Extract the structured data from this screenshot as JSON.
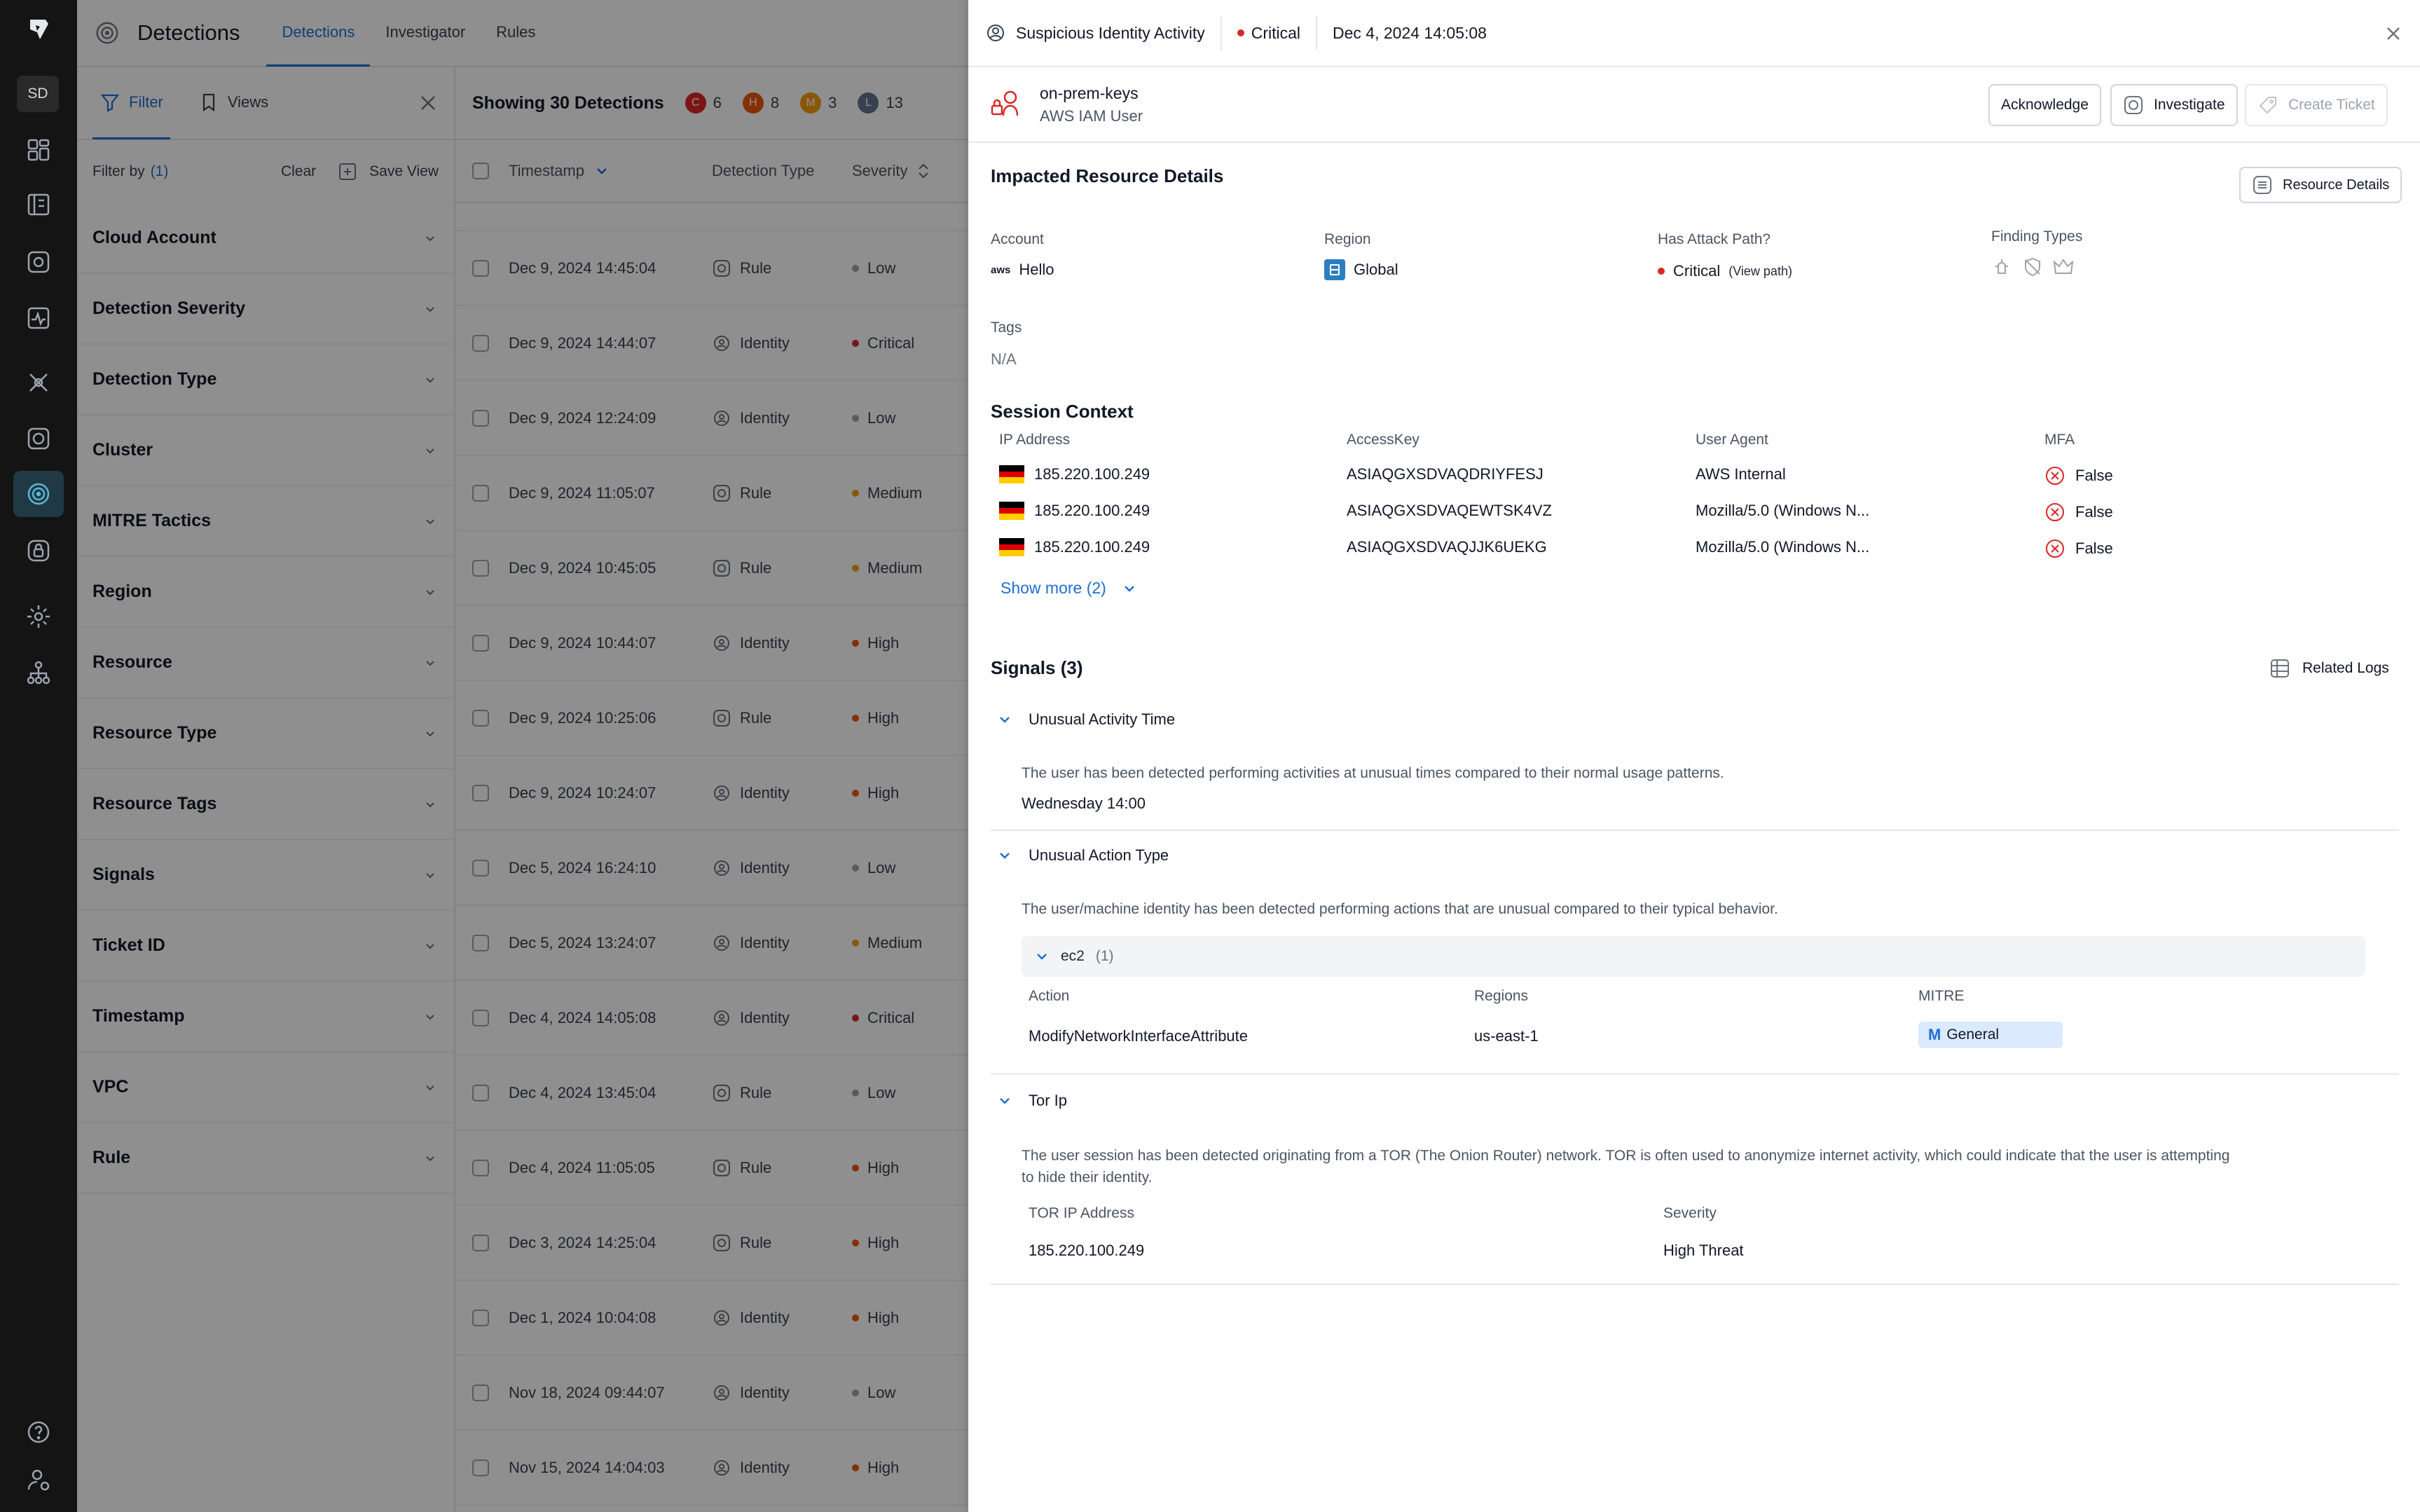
{
  "rail": {
    "workspace": "SD",
    "icons": [
      "dashboard-icon",
      "inventory-icon",
      "explorer-icon",
      "posture-icon",
      "activity-icon",
      "vulnerability-icon",
      "compliance-icon",
      "detections-icon",
      "identity-icon",
      "settings-icon",
      "org-icon"
    ],
    "bottom": [
      "help-icon",
      "user-settings-icon"
    ]
  },
  "app": {
    "title": "Detections",
    "tabs": [
      "Detections",
      "Investigator",
      "Rules"
    ]
  },
  "filter_panel": {
    "tabs": [
      "Filter",
      "Views"
    ],
    "filter_by": "Filter by",
    "filter_count": "(1)",
    "clear": "Clear",
    "save_view": "Save View",
    "groups": [
      "Cloud Account",
      "Detection Severity",
      "Detection Type",
      "Cluster",
      "MITRE Tactics",
      "Region",
      "Resource",
      "Resource Type",
      "Resource Tags",
      "Signals",
      "Ticket ID",
      "Timestamp",
      "VPC",
      "Rule"
    ]
  },
  "detections_table": {
    "showing": "Showing 30 Detections",
    "severity_counts": [
      {
        "letter": "C",
        "count": "6",
        "color": "#dc2626"
      },
      {
        "letter": "H",
        "count": "8",
        "color": "#ea580c"
      },
      {
        "letter": "M",
        "count": "3",
        "color": "#f59e0b"
      },
      {
        "letter": "L",
        "count": "13",
        "color": "#64748b"
      }
    ],
    "columns": [
      "Timestamp",
      "Detection Type",
      "Severity"
    ],
    "rows": [
      {
        "ts": "Dec 9, 2024 14:45:04",
        "type": "Rule",
        "sev": "Low"
      },
      {
        "ts": "Dec 9, 2024 14:44:07",
        "type": "Identity",
        "sev": "Critical"
      },
      {
        "ts": "Dec 9, 2024 12:24:09",
        "type": "Identity",
        "sev": "Low"
      },
      {
        "ts": "Dec 9, 2024 11:05:07",
        "type": "Rule",
        "sev": "Medium"
      },
      {
        "ts": "Dec 9, 2024 10:45:05",
        "type": "Rule",
        "sev": "Medium"
      },
      {
        "ts": "Dec 9, 2024 10:44:07",
        "type": "Identity",
        "sev": "High"
      },
      {
        "ts": "Dec 9, 2024 10:25:06",
        "type": "Rule",
        "sev": "High"
      },
      {
        "ts": "Dec 9, 2024 10:24:07",
        "type": "Identity",
        "sev": "High"
      },
      {
        "ts": "Dec 5, 2024 16:24:10",
        "type": "Identity",
        "sev": "Low"
      },
      {
        "ts": "Dec 5, 2024 13:24:07",
        "type": "Identity",
        "sev": "Medium"
      },
      {
        "ts": "Dec 4, 2024 14:05:08",
        "type": "Identity",
        "sev": "Critical"
      },
      {
        "ts": "Dec 4, 2024 13:45:04",
        "type": "Rule",
        "sev": "Low"
      },
      {
        "ts": "Dec 4, 2024 11:05:05",
        "type": "Rule",
        "sev": "High"
      },
      {
        "ts": "Dec 3, 2024 14:25:04",
        "type": "Rule",
        "sev": "High"
      },
      {
        "ts": "Dec 1, 2024 10:04:08",
        "type": "Identity",
        "sev": "High"
      },
      {
        "ts": "Nov 18, 2024 09:44:07",
        "type": "Identity",
        "sev": "Low"
      },
      {
        "ts": "Nov 15, 2024 14:04:03",
        "type": "Identity",
        "sev": "High"
      }
    ],
    "severity_colors": {
      "Low": "#9ca3af",
      "Critical": "#dc2626",
      "Medium": "#f59e0b",
      "High": "#ea580c"
    }
  },
  "drawer": {
    "header": {
      "title": "Suspicious Identity Activity",
      "severity": "Critical",
      "timestamp": "Dec 4, 2024 14:05:08"
    },
    "identity": {
      "name": "on-prem-keys",
      "type": "AWS IAM User"
    },
    "actions": {
      "acknowledge": "Acknowledge",
      "investigate": "Investigate",
      "create_ticket": "Create Ticket"
    },
    "impacted": {
      "title": "Impacted Resource Details",
      "resource_details": "Resource Details",
      "account_label": "Account",
      "account_value": "Hello",
      "account_logo": "aws",
      "region_label": "Region",
      "region_value": "Global",
      "attack_label": "Has Attack Path?",
      "attack_value": "Critical",
      "attack_link": "(View path)",
      "finding_label": "Finding Types",
      "tags_label": "Tags",
      "tags_value": "N/A"
    },
    "session": {
      "title": "Session Context",
      "headers": [
        "IP Address",
        "AccessKey",
        "User Agent",
        "MFA"
      ],
      "rows": [
        {
          "ip": "185.220.100.249",
          "key": "ASIAQGXSDVAQDRIYFESJ",
          "agent": "AWS Internal",
          "mfa": "False"
        },
        {
          "ip": "185.220.100.249",
          "key": "ASIAQGXSDVAQEWTSK4VZ",
          "agent": "Mozilla/5.0 (Windows N...",
          "mfa": "False"
        },
        {
          "ip": "185.220.100.249",
          "key": "ASIAQGXSDVAQJJK6UEKG",
          "agent": "Mozilla/5.0 (Windows N...",
          "mfa": "False"
        }
      ],
      "show_more": "Show more (2)"
    },
    "signals": {
      "title": "Signals (3)",
      "related_logs": "Related Logs",
      "s1": {
        "title": "Unusual Activity Time",
        "desc": "The user has been detected performing activities at unusual times compared to their normal usage patterns.",
        "detail": "Wednesday 14:00"
      },
      "s2": {
        "title": "Unusual Action Type",
        "desc": "The user/machine identity has been detected performing actions that are unusual compared to their typical behavior.",
        "service": "ec2",
        "service_count": "(1)",
        "col_action": "Action",
        "col_regions": "Regions",
        "col_mitre": "MITRE",
        "action": "ModifyNetworkInterfaceAttribute",
        "region": "us-east-1",
        "mitre_letter": "M",
        "mitre": "General"
      },
      "s3": {
        "title": "Tor Ip",
        "desc_line1": "The user session has been detected originating from a TOR (The Onion Router) network. TOR is often used to anonymize internet activity, which could indicate that the user is attempting",
        "desc_line2": "to hide their identity.",
        "col_ip": "TOR IP Address",
        "col_sev": "Severity",
        "ip": "185.220.100.249",
        "sev": "High Threat"
      }
    }
  }
}
